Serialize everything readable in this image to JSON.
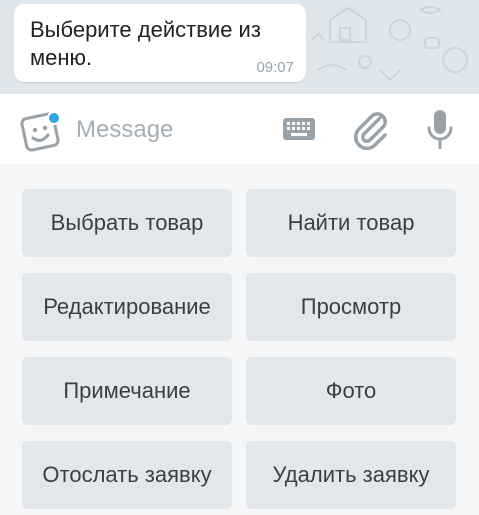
{
  "chat": {
    "message": {
      "text": "Выберите действие из меню.",
      "time": "09:07"
    }
  },
  "composer": {
    "placeholder": "Message",
    "icons": {
      "sticker": "sticker-smiley-icon",
      "keyboard": "keyboard-icon",
      "attach": "paperclip-icon",
      "mic": "microphone-icon"
    },
    "accent_dot_color": "#2ba5e8"
  },
  "keyboard": {
    "buttons": [
      [
        "Выбрать товар",
        "Найти товар"
      ],
      [
        "Редактирование",
        "Просмотр"
      ],
      [
        "Примечание",
        "Фото"
      ],
      [
        "Отослать заявку",
        "Удалить заявку"
      ]
    ]
  },
  "colors": {
    "wallpaper": "#dfe6ec",
    "keyboard_bg": "#f5f6f7",
    "button_bg": "#e4e7ea",
    "icon_gray": "#9aa2a9"
  }
}
